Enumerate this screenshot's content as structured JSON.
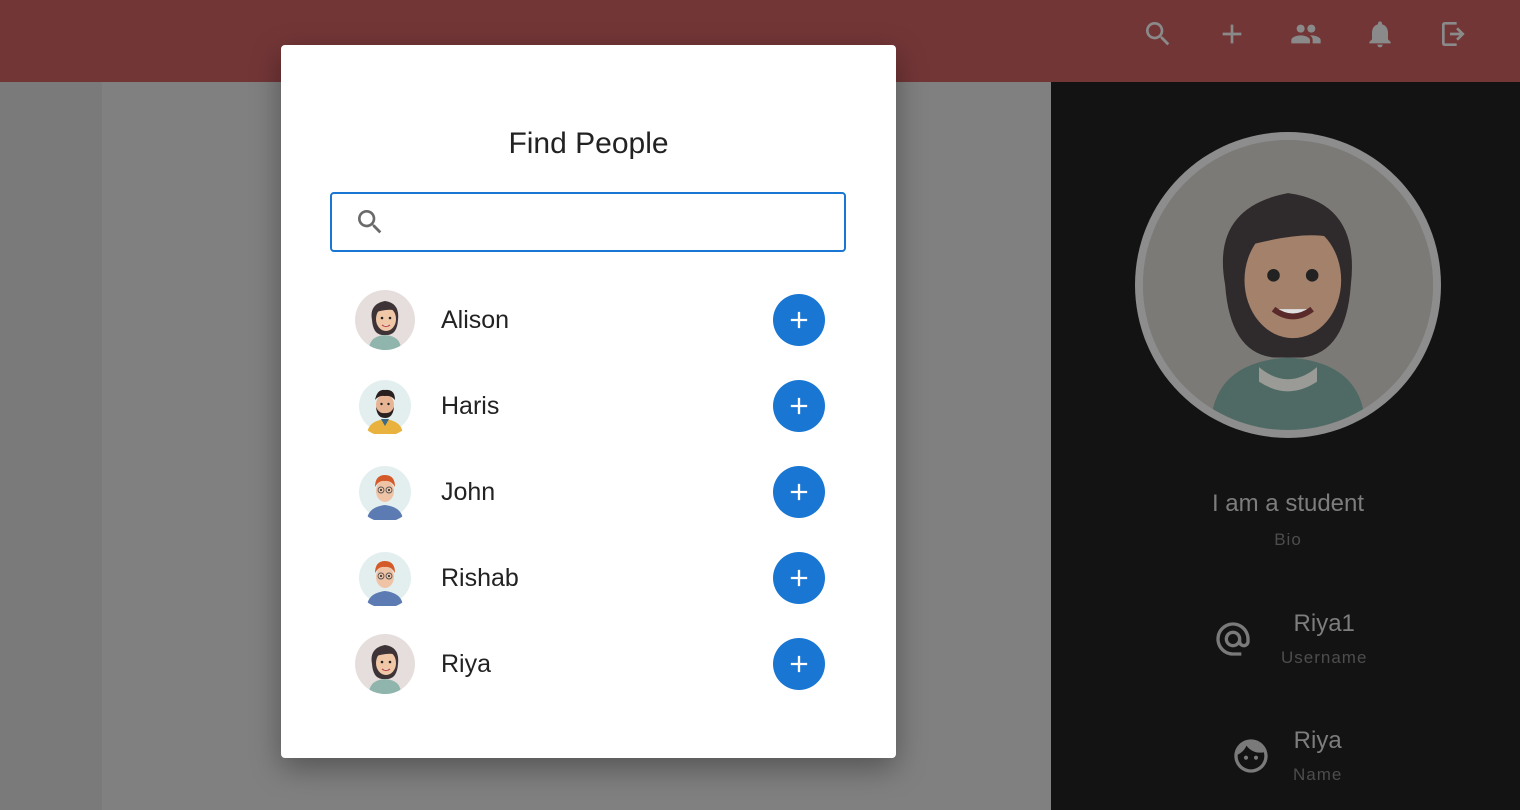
{
  "topbar": {
    "actions": [
      {
        "icon": "search-icon"
      },
      {
        "icon": "add-icon"
      },
      {
        "icon": "people-icon"
      },
      {
        "icon": "bell-icon"
      },
      {
        "icon": "logout-icon"
      }
    ],
    "bar_color": "#733637"
  },
  "profile": {
    "bio": "I am a student",
    "bio_label": "Bio",
    "username": "Riya1",
    "username_label": "Username",
    "name": "Riya",
    "name_label": "Name"
  },
  "dialog": {
    "title": "Find People",
    "search_value": "",
    "search_placeholder": "",
    "people": [
      {
        "name": "Alison",
        "avatar": "female-avatar"
      },
      {
        "name": "Haris",
        "avatar": "bearded-male-avatar"
      },
      {
        "name": "John",
        "avatar": "red-haired-male-avatar"
      },
      {
        "name": "Rishab",
        "avatar": "red-haired-male-avatar"
      },
      {
        "name": "Riya",
        "avatar": "female-avatar"
      }
    ],
    "accent_color": "#1976d2"
  }
}
